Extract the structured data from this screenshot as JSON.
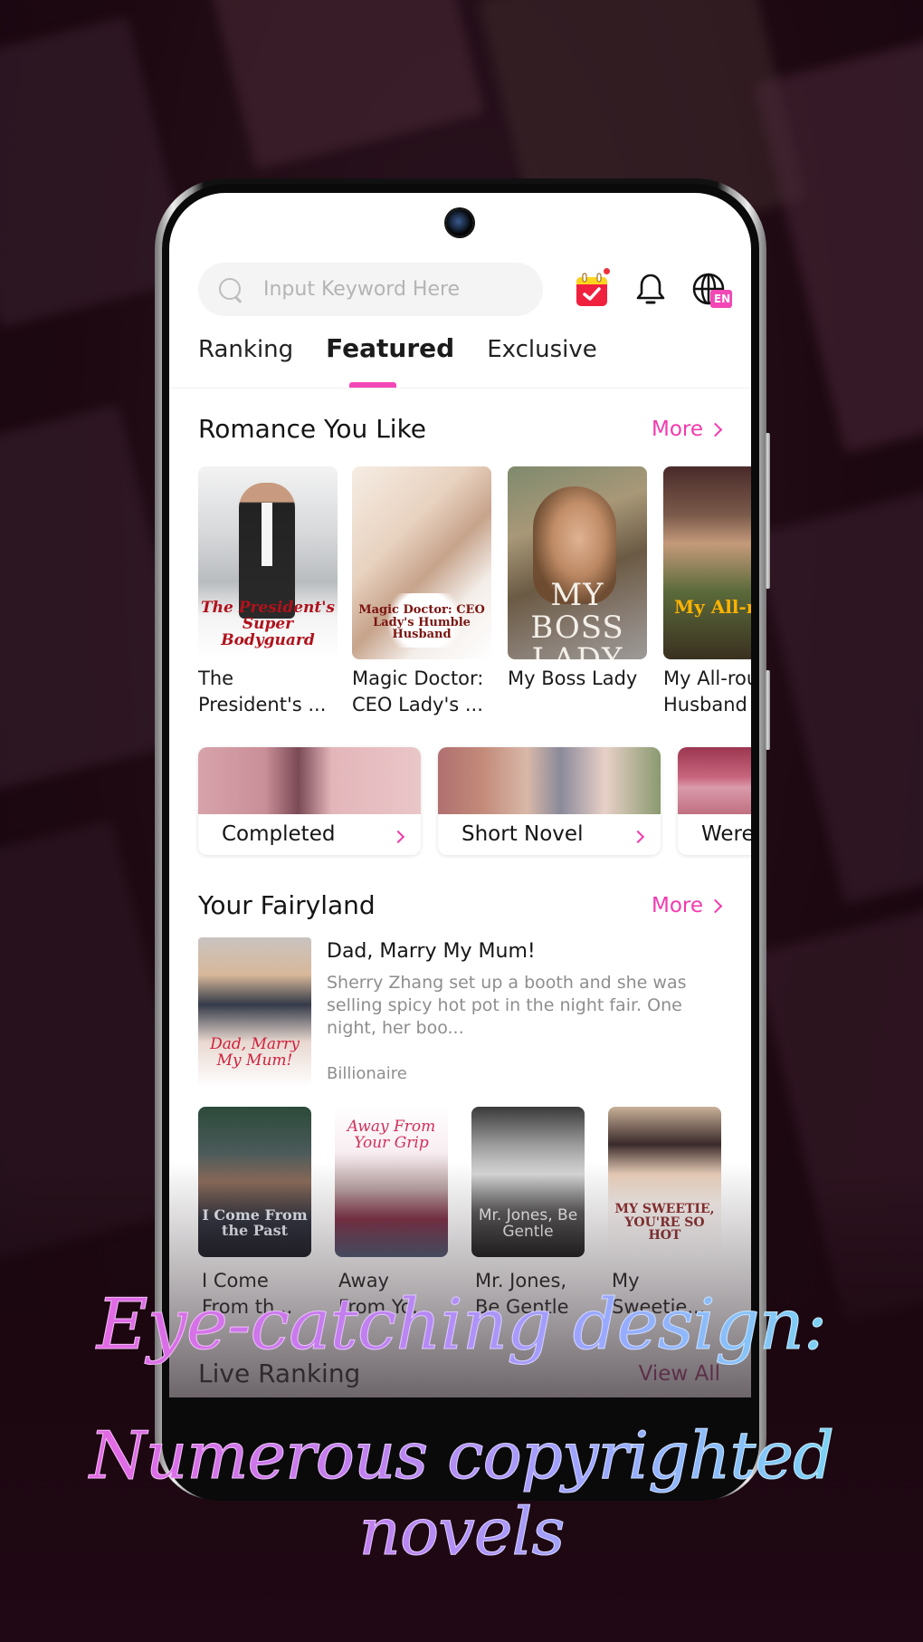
{
  "header": {
    "search_placeholder": "Input Keyword Here",
    "icons": [
      "calendar-checkin-icon",
      "bell-icon",
      "globe-language-icon"
    ],
    "language_badge": "EN",
    "checkin_has_notification": true
  },
  "tabs": [
    {
      "label": "Ranking",
      "active": false
    },
    {
      "label": "Featured",
      "active": true
    },
    {
      "label": "Exclusive",
      "active": false
    }
  ],
  "sections": {
    "romance": {
      "title": "Romance You Like",
      "more_label": "More",
      "books": [
        {
          "title": "The President's ...",
          "cover_text": "The President's Super Bodyguard"
        },
        {
          "title": "Magic Doctor: CEO Lady's ...",
          "cover_text": "Magic Doctor: CEO Lady's Humble Husband"
        },
        {
          "title": "My Boss Lady",
          "cover_text": "MY BOSS LADY"
        },
        {
          "title": "My All-round Husband",
          "cover_text": "My All-round Husband"
        }
      ]
    },
    "categories": [
      {
        "label": "Completed"
      },
      {
        "label": "Short Novel"
      },
      {
        "label": "Werewolf"
      }
    ],
    "fairyland": {
      "title": "Your Fairyland",
      "more_label": "More",
      "featured": {
        "title": "Dad, Marry My Mum!",
        "description": "Sherry Zhang set up a booth and she was selling spicy hot pot in the night fair. One night, her boo...",
        "tag": "Billionaire",
        "cover_text": "Dad, Marry My Mum!"
      },
      "books": [
        {
          "title_l1": "I Come",
          "title_l2": "From th...",
          "cover_text": "I Come From the Past"
        },
        {
          "title_l1": "Away",
          "title_l2": "From Yo...",
          "cover_text": "Away From Your Grip"
        },
        {
          "title_l1": "Mr. Jones,",
          "title_l2": "Be Gentle",
          "cover_text": "Mr. Jones, Be Gentle"
        },
        {
          "title_l1": "My",
          "title_l2": "Sweetie...",
          "cover_text": "MY SWEETIE, YOU'RE SO HOT"
        }
      ]
    },
    "live_ranking": {
      "title": "Live Ranking",
      "view_all_label": "View All"
    }
  },
  "colors": {
    "accent": "#f23aae",
    "tab_indicator": "#f347b6",
    "background": "#1c0710"
  },
  "promo": {
    "line1": "Eye-catching design:",
    "line2": "Numerous copyrighted novels"
  }
}
